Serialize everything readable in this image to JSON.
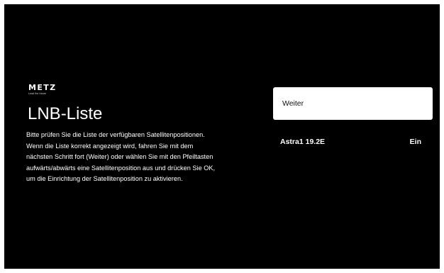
{
  "brand": {
    "name": "METZ",
    "tagline": "Lead the future"
  },
  "page": {
    "title": "LNB-Liste",
    "description": "Bitte prüfen Sie die Liste der verfügbaren Satellitenpositionen. Wenn die Liste korrekt angezeigt wird, fahren Sie mit dem nächsten Schritt fort (Weiter) oder wählen Sie mit den Pfeiltasten aufwärts/abwärts eine Satellitenposition aus und drücken Sie OK, um die Einrichtung der Satellitenposition zu aktivieren."
  },
  "actions": {
    "next_label": "Weiter"
  },
  "satellites": [
    {
      "name": "Astra1 19.2E",
      "status": "Ein"
    }
  ],
  "colors": {
    "background": "#000000",
    "text": "#ffffff",
    "focus_background": "#ffffff",
    "focus_text": "#111111"
  }
}
